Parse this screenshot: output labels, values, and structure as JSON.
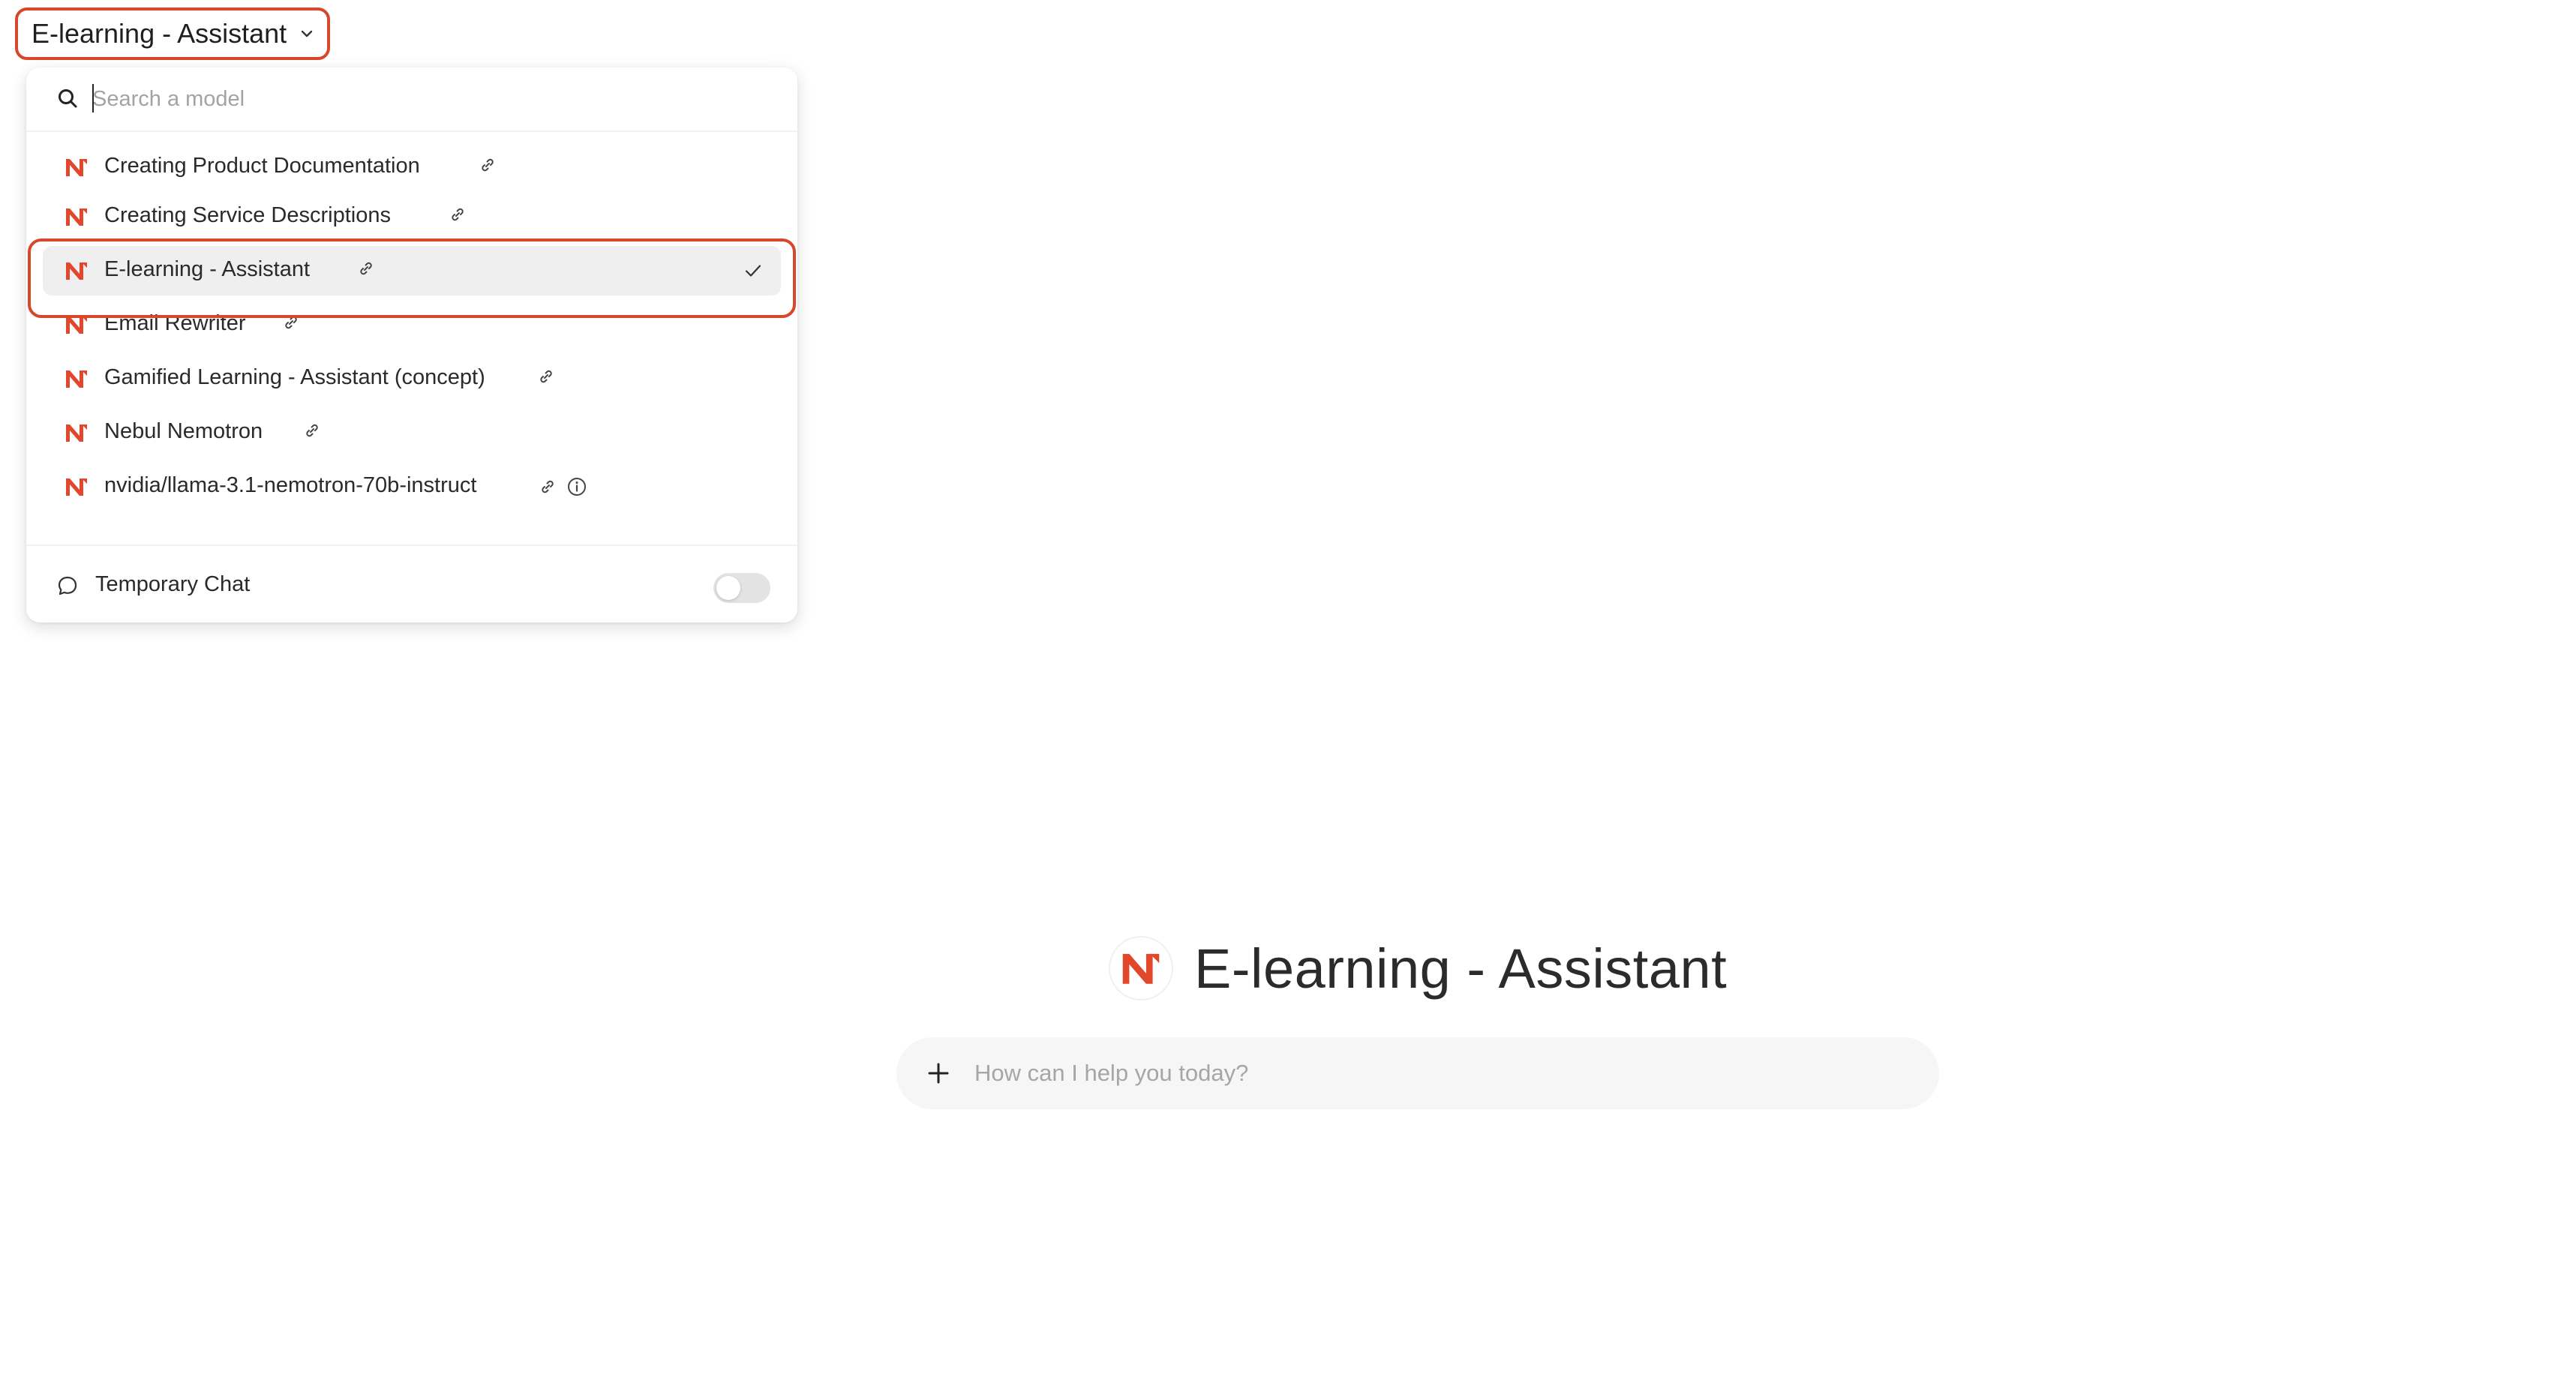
{
  "header": {
    "selected_model": "E-learning - Assistant"
  },
  "dropdown": {
    "search_placeholder": "Search a model",
    "models": [
      {
        "name": "Creating Product Documentation",
        "has_link": true,
        "has_info": false,
        "selected": false
      },
      {
        "name": "Creating Service Descriptions",
        "has_link": true,
        "has_info": false,
        "selected": false
      },
      {
        "name": "E-learning - Assistant",
        "has_link": true,
        "has_info": false,
        "selected": true
      },
      {
        "name": "Email Rewriter",
        "has_link": true,
        "has_info": false,
        "selected": false
      },
      {
        "name": "Gamified Learning - Assistant (concept)",
        "has_link": true,
        "has_info": false,
        "selected": false
      },
      {
        "name": "Nebul Nemotron",
        "has_link": true,
        "has_info": false,
        "selected": false
      },
      {
        "name": "nvidia/llama-3.1-nemotron-70b-instruct",
        "has_link": true,
        "has_info": true,
        "selected": false
      }
    ],
    "temporary_chat": {
      "label": "Temporary Chat",
      "enabled": false
    }
  },
  "main": {
    "title": "E-learning - Assistant",
    "composer_placeholder": "How can I help you today?"
  },
  "colors": {
    "accent": "#d9472b",
    "brand_logo": "#e2462b",
    "selected_row_bg": "#efefef",
    "composer_bg": "#f6f6f6"
  },
  "icons": {
    "search": "search-icon",
    "chevron": "chevron-down-icon",
    "link": "link-icon",
    "info": "info-icon",
    "check": "check-icon",
    "chat": "chat-bubble-icon",
    "plus": "plus-icon",
    "logo": "nebul-logo-icon"
  }
}
